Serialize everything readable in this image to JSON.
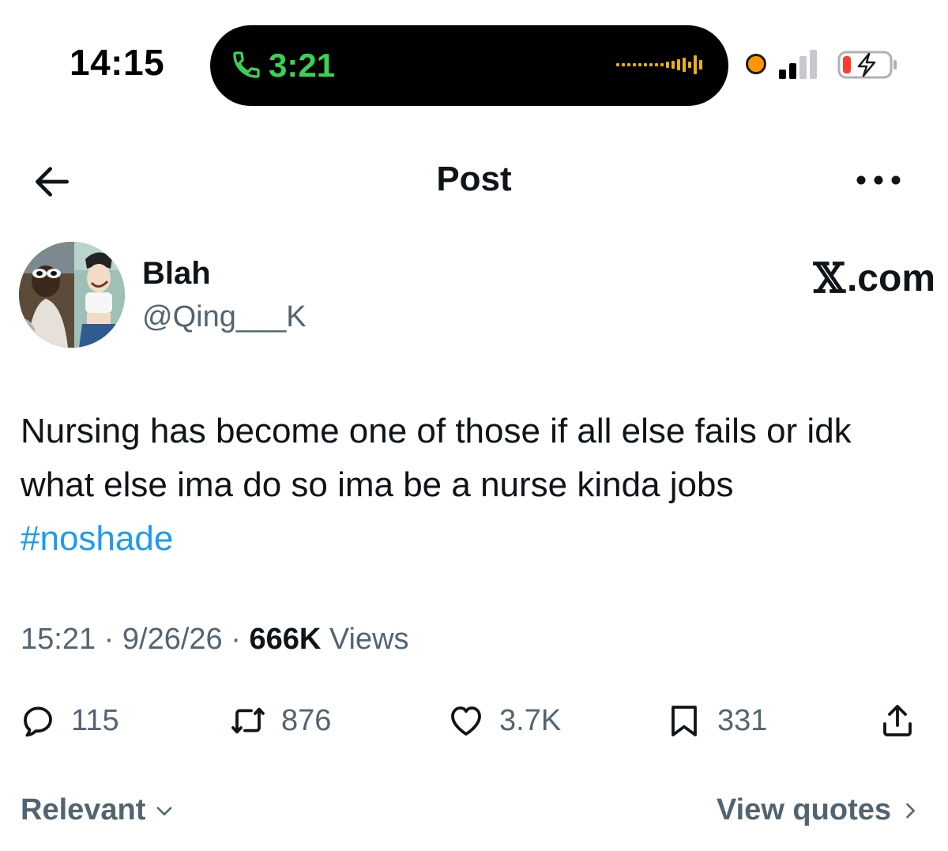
{
  "status_bar": {
    "time": "14:15",
    "call_duration": "3:21",
    "call_color": "#39d353",
    "privacy_dot_color": "#ff9500",
    "battery_color": "#ff3b30",
    "icons": [
      "phone-icon",
      "audio-waveform-icon",
      "mic-indicator-dot",
      "signal-bars-icon",
      "battery-charging-icon"
    ]
  },
  "header": {
    "title": "Post",
    "back_icon": "arrow-left-icon",
    "more_icon": "more-horizontal-icon"
  },
  "author": {
    "display_name": "Blah",
    "handle": "@Qing___K",
    "watermark": "X.com",
    "watermark_glyph": "𝕏",
    "watermark_suffix": ".com"
  },
  "tweet": {
    "text": "Nursing has become one of those if all else fails or idk what else ima do so ima be a nurse kinda jobs",
    "hashtag": "#noshade",
    "hashtag_color": "#1d9bf0"
  },
  "meta": {
    "time": "15:21",
    "separator": " · ",
    "date": "9/26/26",
    "views_count": "666K",
    "views_label": "Views"
  },
  "actions": {
    "replies": "115",
    "reposts": "876",
    "likes": "3.7K",
    "bookmarks": "331",
    "icons": [
      "reply-icon",
      "repost-icon",
      "like-icon",
      "bookmark-icon",
      "share-icon"
    ]
  },
  "footer": {
    "sort_label": "Relevant",
    "quotes_label": "View quotes"
  },
  "colors": {
    "text_primary": "#0f1419",
    "text_secondary": "#536471",
    "accent": "#1d9bf0"
  }
}
